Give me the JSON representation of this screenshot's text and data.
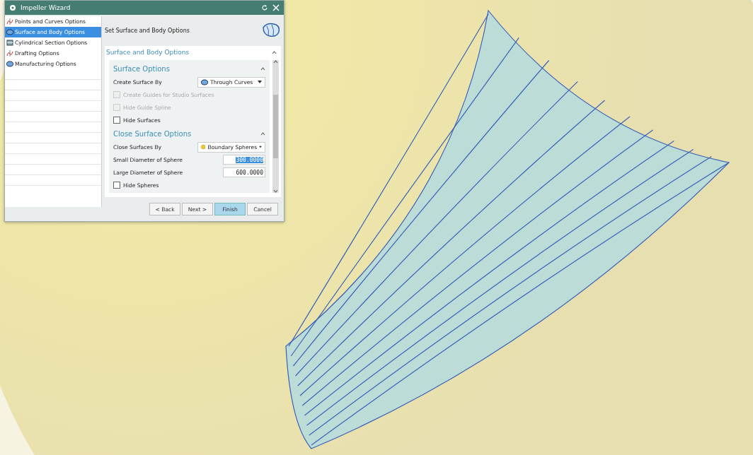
{
  "window": {
    "title": "Impeller Wizard"
  },
  "steps": [
    {
      "label": "Points and Curves Options",
      "selected": false,
      "kind": "curve"
    },
    {
      "label": "Surface and Body Options",
      "selected": true,
      "kind": "surface"
    },
    {
      "label": "Cylindrical Section Options",
      "selected": false,
      "kind": "section"
    },
    {
      "label": "Drafting Options",
      "selected": false,
      "kind": "curve"
    },
    {
      "label": "Manufacturing Options",
      "selected": false,
      "kind": "surface"
    }
  ],
  "page_title": "Set Surface and Body Options",
  "section": {
    "title": "Surface and Body Options",
    "expanded": true
  },
  "groups": [
    {
      "title": "Surface Options",
      "expanded": true,
      "rows": [
        {
          "kind": "dropdown",
          "label": "Create Surface By",
          "value": "Through Curves"
        },
        {
          "kind": "checkbox",
          "label": "Create Guides for Studio Surfaces",
          "checked": false,
          "disabled": true
        },
        {
          "kind": "checkbox",
          "label": "Hide Guide Spline",
          "checked": false,
          "disabled": true
        },
        {
          "kind": "checkbox",
          "label": "Hide Surfaces",
          "checked": false,
          "disabled": false
        }
      ]
    },
    {
      "title": "Close Surface Options",
      "expanded": true,
      "rows": [
        {
          "kind": "dropdown",
          "label": "Close Surfaces By",
          "value": "Boundary Spheres"
        },
        {
          "kind": "number",
          "label": "Small Diameter of Sphere",
          "value": "300.0000",
          "selected": true
        },
        {
          "kind": "number",
          "label": "Large Diameter of Sphere",
          "value": "600.0000",
          "selected": false
        },
        {
          "kind": "checkbox",
          "label": "Hide Spheres",
          "checked": false,
          "disabled": false
        }
      ]
    }
  ],
  "buttons": [
    {
      "label": "< Back",
      "selected": false
    },
    {
      "label": "Next >",
      "selected": false
    },
    {
      "label": "Finish",
      "selected": true
    },
    {
      "label": "Cancel",
      "selected": false
    }
  ]
}
